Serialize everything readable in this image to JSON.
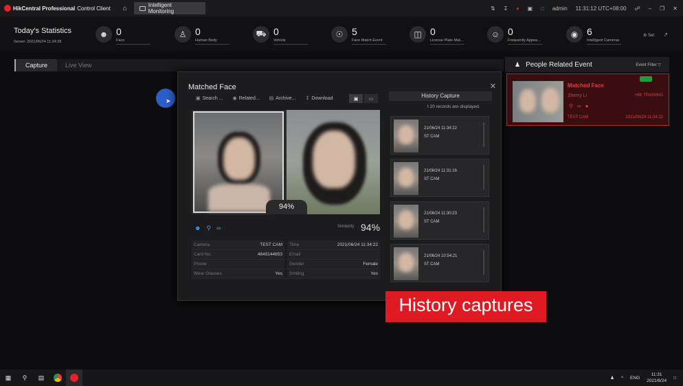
{
  "titlebar": {
    "app_name_bold": "HikCentral Professional",
    "app_name_rest": "Control Client",
    "tab_label": "Intelligent Monitoring",
    "user": "admin",
    "clock": "11:31:12 UTC+08:00"
  },
  "stats": {
    "title": "Today's Statistics",
    "server": "Server: 2021/06/24  11:34:28",
    "items": [
      {
        "label": "Face",
        "value": "0"
      },
      {
        "label": "Human Body",
        "value": "0"
      },
      {
        "label": "Vehicle",
        "value": "0"
      },
      {
        "label": "Face Match Event",
        "value": "5"
      },
      {
        "label": "License Plate Mat...",
        "value": "0"
      },
      {
        "label": "Frequently Appea...",
        "value": "0"
      },
      {
        "label": "Intelligent Cameras",
        "value": "6"
      }
    ],
    "set_label": "Set"
  },
  "subtabs": {
    "capture": "Capture",
    "live_view": "Live View"
  },
  "modal": {
    "title": "Matched Face",
    "tools": [
      "Search ...",
      "Related...",
      "Archive...",
      "Download"
    ],
    "match_percent": "94%",
    "similarity_label": "Similarity",
    "similarity_value": "94%",
    "info": [
      {
        "k1": "Camera",
        "v1": "TEST CAM",
        "k2": "Time",
        "v2": "2021/06/24 11:34:22"
      },
      {
        "k1": "Card No.",
        "v1": "4649144653",
        "k2": "Email",
        "v2": ""
      },
      {
        "k1": "Phone",
        "v1": "",
        "k2": "Gender",
        "v2": "Female"
      },
      {
        "k1": "Wear Glasses",
        "v1": "Yes",
        "k2": "Smiling",
        "v2": "Yes"
      }
    ]
  },
  "history": {
    "title": "History Capture",
    "note": "t 20 records are displayed.",
    "items": [
      {
        "time": "21/06/24 11:34:22",
        "cam": "ST CAM"
      },
      {
        "time": "21/06/24 11:31:16",
        "cam": "ST CAM"
      },
      {
        "time": "21/06/24 11:30:23",
        "cam": "ST CAM"
      },
      {
        "time": "21/06/24 10:54:21",
        "cam": "ST CAM"
      }
    ]
  },
  "overlay_caption": "History  captures",
  "people": {
    "title": "People Related Event",
    "filter": "Event Filter",
    "event": {
      "type": "Matched Face",
      "name": "Sherry Li",
      "group": "HIK TRAINING",
      "camera": "TEST CAM",
      "time": "2021/06/24 11:34:22"
    }
  },
  "taskbar": {
    "lang": "ENG",
    "time": "11:31",
    "date": "2021/6/24"
  }
}
